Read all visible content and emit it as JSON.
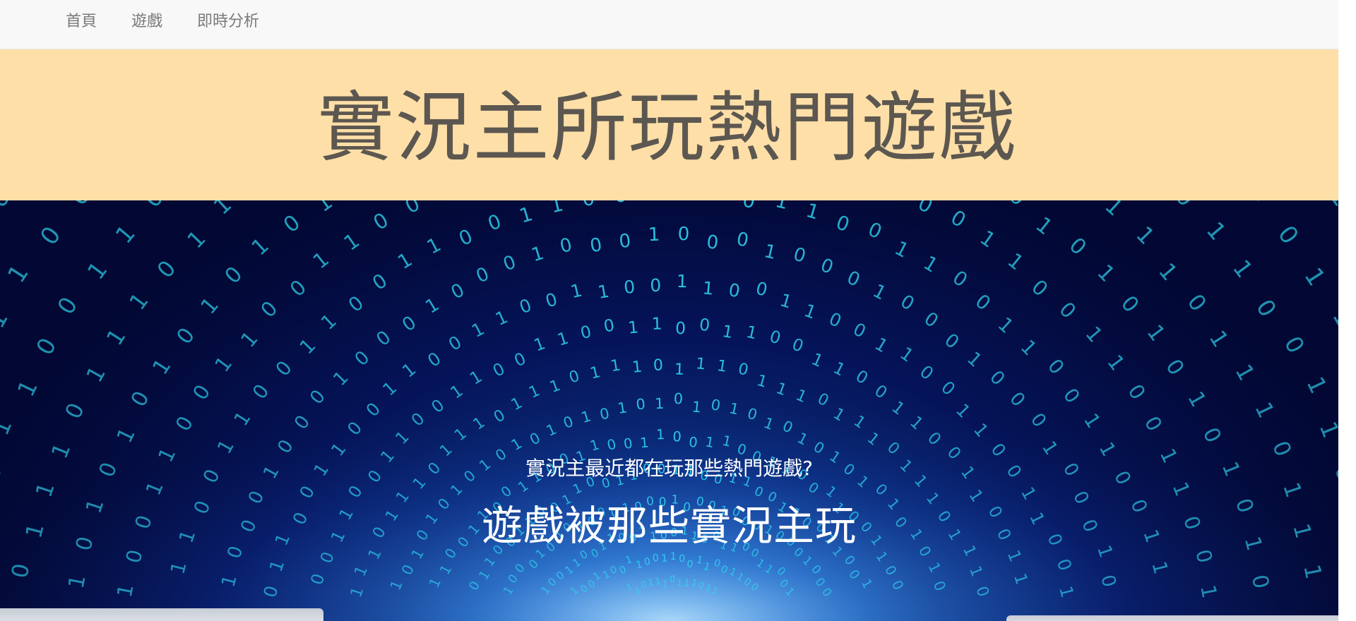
{
  "nav": {
    "items": [
      {
        "label": "首頁"
      },
      {
        "label": "遊戲"
      },
      {
        "label": "即時分析"
      }
    ]
  },
  "banner": {
    "title": "實況主所玩熱門遊戲"
  },
  "hero": {
    "subtitle": "實況主最近都在玩那些熱門遊戲?",
    "headline": "遊戲被那些實況主玩",
    "digits": "0110100101100011010110010101"
  },
  "colors": {
    "banner_bg": "#ffdfa8",
    "title_text": "#5c5750",
    "nav_bg": "#f8f8f8",
    "nav_text": "#7a7a7a",
    "hero_bg": "#05145a",
    "digit_color": "#2fd6f0"
  }
}
